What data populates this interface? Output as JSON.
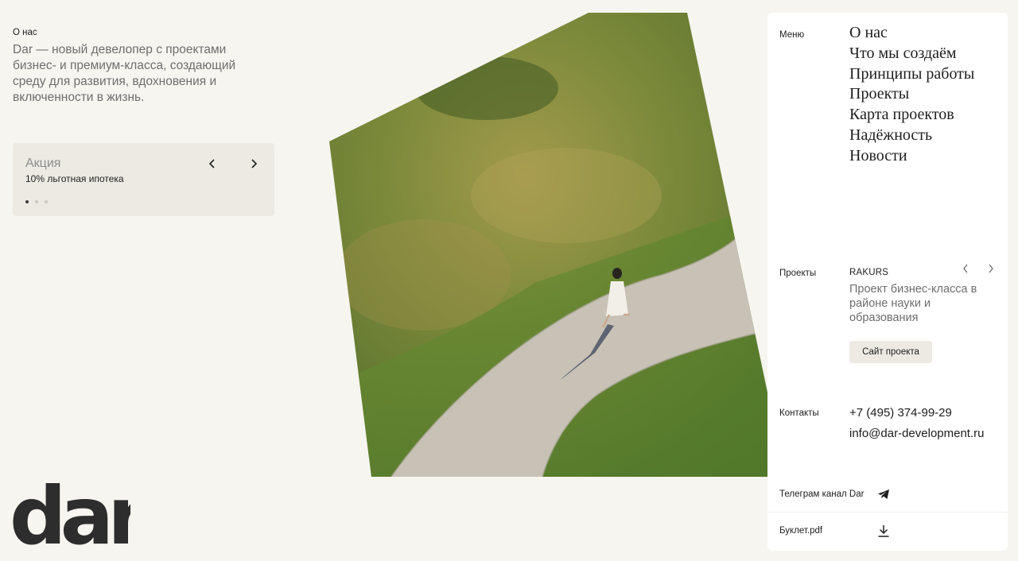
{
  "about": {
    "label": "О нас",
    "text": "Dar — новый девелопер с проектами бизнес- и премиум-класса, создающий среду для развития, вдохновения и включенности в жизнь."
  },
  "promo": {
    "title": "Акция",
    "subtitle": "10% льготная ипотека",
    "prev_icon": "chevron-left-icon",
    "next_icon": "chevron-right-icon",
    "slides": 3,
    "active_slide": 1
  },
  "logo": {
    "text": "dar"
  },
  "photo": {
    "alt": "aerial-path-walker-image"
  },
  "menu": {
    "label": "Меню",
    "items": [
      "О нас",
      "Что мы создаём",
      "Принципы работы",
      "Проекты",
      "Карта проектов",
      "Надёжность",
      "Новости"
    ]
  },
  "projects": {
    "label": "Проекты",
    "name": "RAKURS",
    "description": "Проект бизнес-класса в районе науки и образования",
    "button": "Сайт проекта"
  },
  "contacts": {
    "label": "Контакты",
    "phone": "+7 (495) 374-99-29",
    "email": "info@dar-development.ru"
  },
  "telegram": {
    "label": "Телеграм канал Dar",
    "icon": "telegram-icon"
  },
  "booklet": {
    "label": "Буклет.pdf",
    "icon": "download-icon"
  },
  "colors": {
    "background": "#f6f5f0",
    "panel": "#ffffff",
    "chip": "#eceae3",
    "text": "#1e1e1e",
    "muted": "#6e6e6e"
  }
}
